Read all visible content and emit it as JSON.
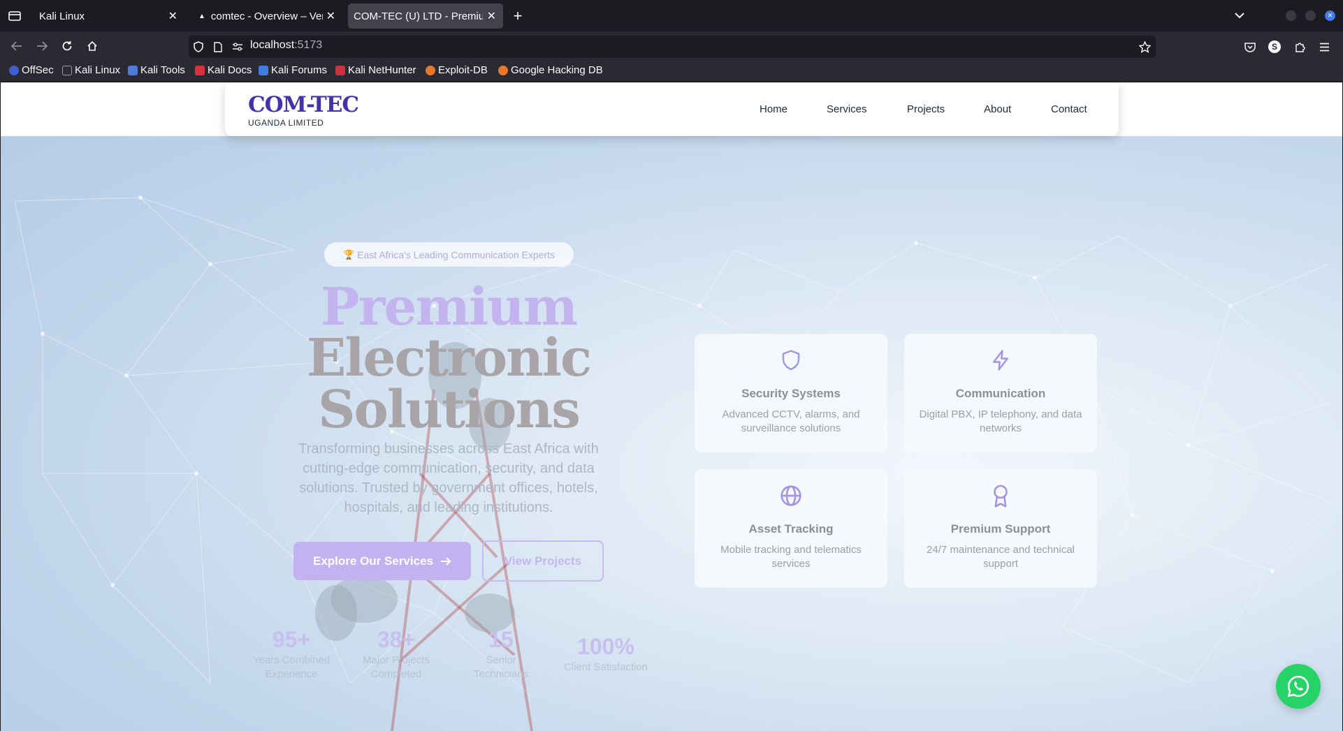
{
  "browser": {
    "tabs": [
      {
        "label": "Kali Linux"
      },
      {
        "label": "comtec - Overview – Verc"
      },
      {
        "label": "COM-TEC (U) LTD - Premium"
      }
    ],
    "url_host": "localhost",
    "url_port": ":5173",
    "bookmarks": [
      "OffSec",
      "Kali Linux",
      "Kali Tools",
      "Kali Docs",
      "Kali Forums",
      "Kali NetHunter",
      "Exploit-DB",
      "Google Hacking DB"
    ],
    "extension_badge": "S"
  },
  "site": {
    "logo_title": "COM-TEC",
    "logo_subtitle": "UGANDA LIMITED",
    "nav": [
      "Home",
      "Services",
      "Projects",
      "About",
      "Contact"
    ]
  },
  "hero": {
    "badge_emoji": "🏆",
    "badge_text": "East Africa's Leading Communication Experts",
    "title_line1": "Premium",
    "title_line2": "Electronic",
    "title_line3": "Solutions",
    "paragraph": "Transforming businesses across East Africa with cutting-edge communication, security, and data solutions. Trusted by government offices, hotels, hospitals, and leading institutions.",
    "primary_cta": "Explore Our Services",
    "secondary_cta": "View Projects"
  },
  "stats": [
    {
      "value": "95+",
      "line1": "Years Combined",
      "line2": "Experience"
    },
    {
      "value": "38+",
      "line1": "Major Projects",
      "line2": "Completed"
    },
    {
      "value": "15",
      "line1": "Senior",
      "line2": "Technicians"
    },
    {
      "value": "100%",
      "line1": "Client Satisfaction",
      "line2": ""
    }
  ],
  "features": [
    {
      "icon": "shield-icon",
      "title": "Security Systems",
      "desc": "Advanced CCTV, alarms, and surveillance solutions"
    },
    {
      "icon": "lightning-icon",
      "title": "Communication",
      "desc": "Digital PBX, IP telephony, and data networks"
    },
    {
      "icon": "globe-icon",
      "title": "Asset Tracking",
      "desc": "Mobile tracking and telematics services"
    },
    {
      "icon": "award-icon",
      "title": "Premium Support",
      "desc": "24/7 maintenance and technical support"
    }
  ],
  "colors": {
    "brand": "#4433a8",
    "accent_light": "#c2b3f0",
    "whatsapp": "#25d366",
    "chrome_dark": "#1c1b22",
    "chrome": "#2b2a33"
  }
}
